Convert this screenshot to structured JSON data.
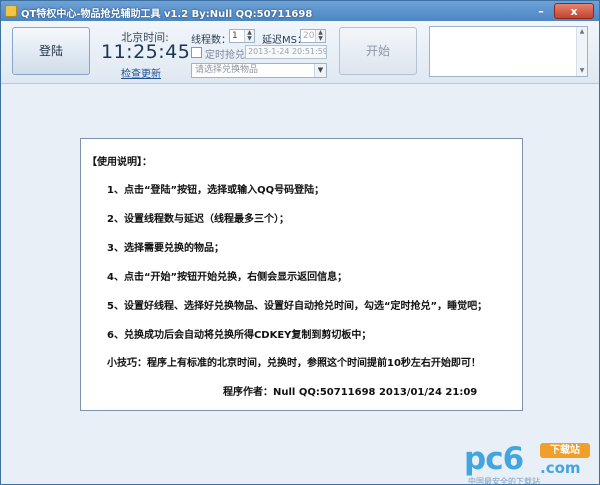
{
  "window": {
    "title": "QT特权中心-物品抢兑辅助工具 v1.2   By:Null   QQ:50711698",
    "minimize_glyph": "–",
    "close_glyph": "x"
  },
  "toolbar": {
    "login_label": "登陆",
    "time_label": "北京时间:",
    "clock": "11:25:45",
    "check_update": "检查更新",
    "threads_label": "线程数：",
    "threads_value": "1",
    "delay_label": "延迟MS：",
    "delay_value": "200",
    "timed_label": "定时抢兑",
    "timed_checked": false,
    "timed_datetime": "2013-1-24 20:51:59",
    "item_select_placeholder": "请选择兑换物品",
    "start_label": "开始"
  },
  "instructions": {
    "title": "【使用说明】：",
    "steps": [
      "1、点击“登陆”按钮，选择或输入QQ号码登陆；",
      "2、设置线程数与延迟（线程最多三个）；",
      "3、选择需要兑换的物品；",
      "4、点击“开始”按钮开始兑换，右侧会显示返回信息；",
      "5、设置好线程、选择好兑换物品、设置好自动抢兑时间，勾选“定时抢兑”，睡觉吧；",
      "6、兑换成功后会自动将兑换所得CDKEY复制到剪切板中；"
    ],
    "tip": "小技巧：程序上有标准的北京时间，兑换时，参照这个时间提前10秒左右开始即可！",
    "author": "程序作者：Null      QQ:50711698      2013/01/24  21:09"
  },
  "watermark": {
    "brand": "pc6",
    "badge": "下载站",
    "domain": ".com",
    "slogan": "中国最安全的下载站"
  },
  "colors": {
    "title_bar": "#4d86c3",
    "window_bg": "#e9eff6",
    "panel_border": "#7d93ab",
    "watermark_blue": "#42a5e0",
    "watermark_orange": "#f0a02a"
  }
}
